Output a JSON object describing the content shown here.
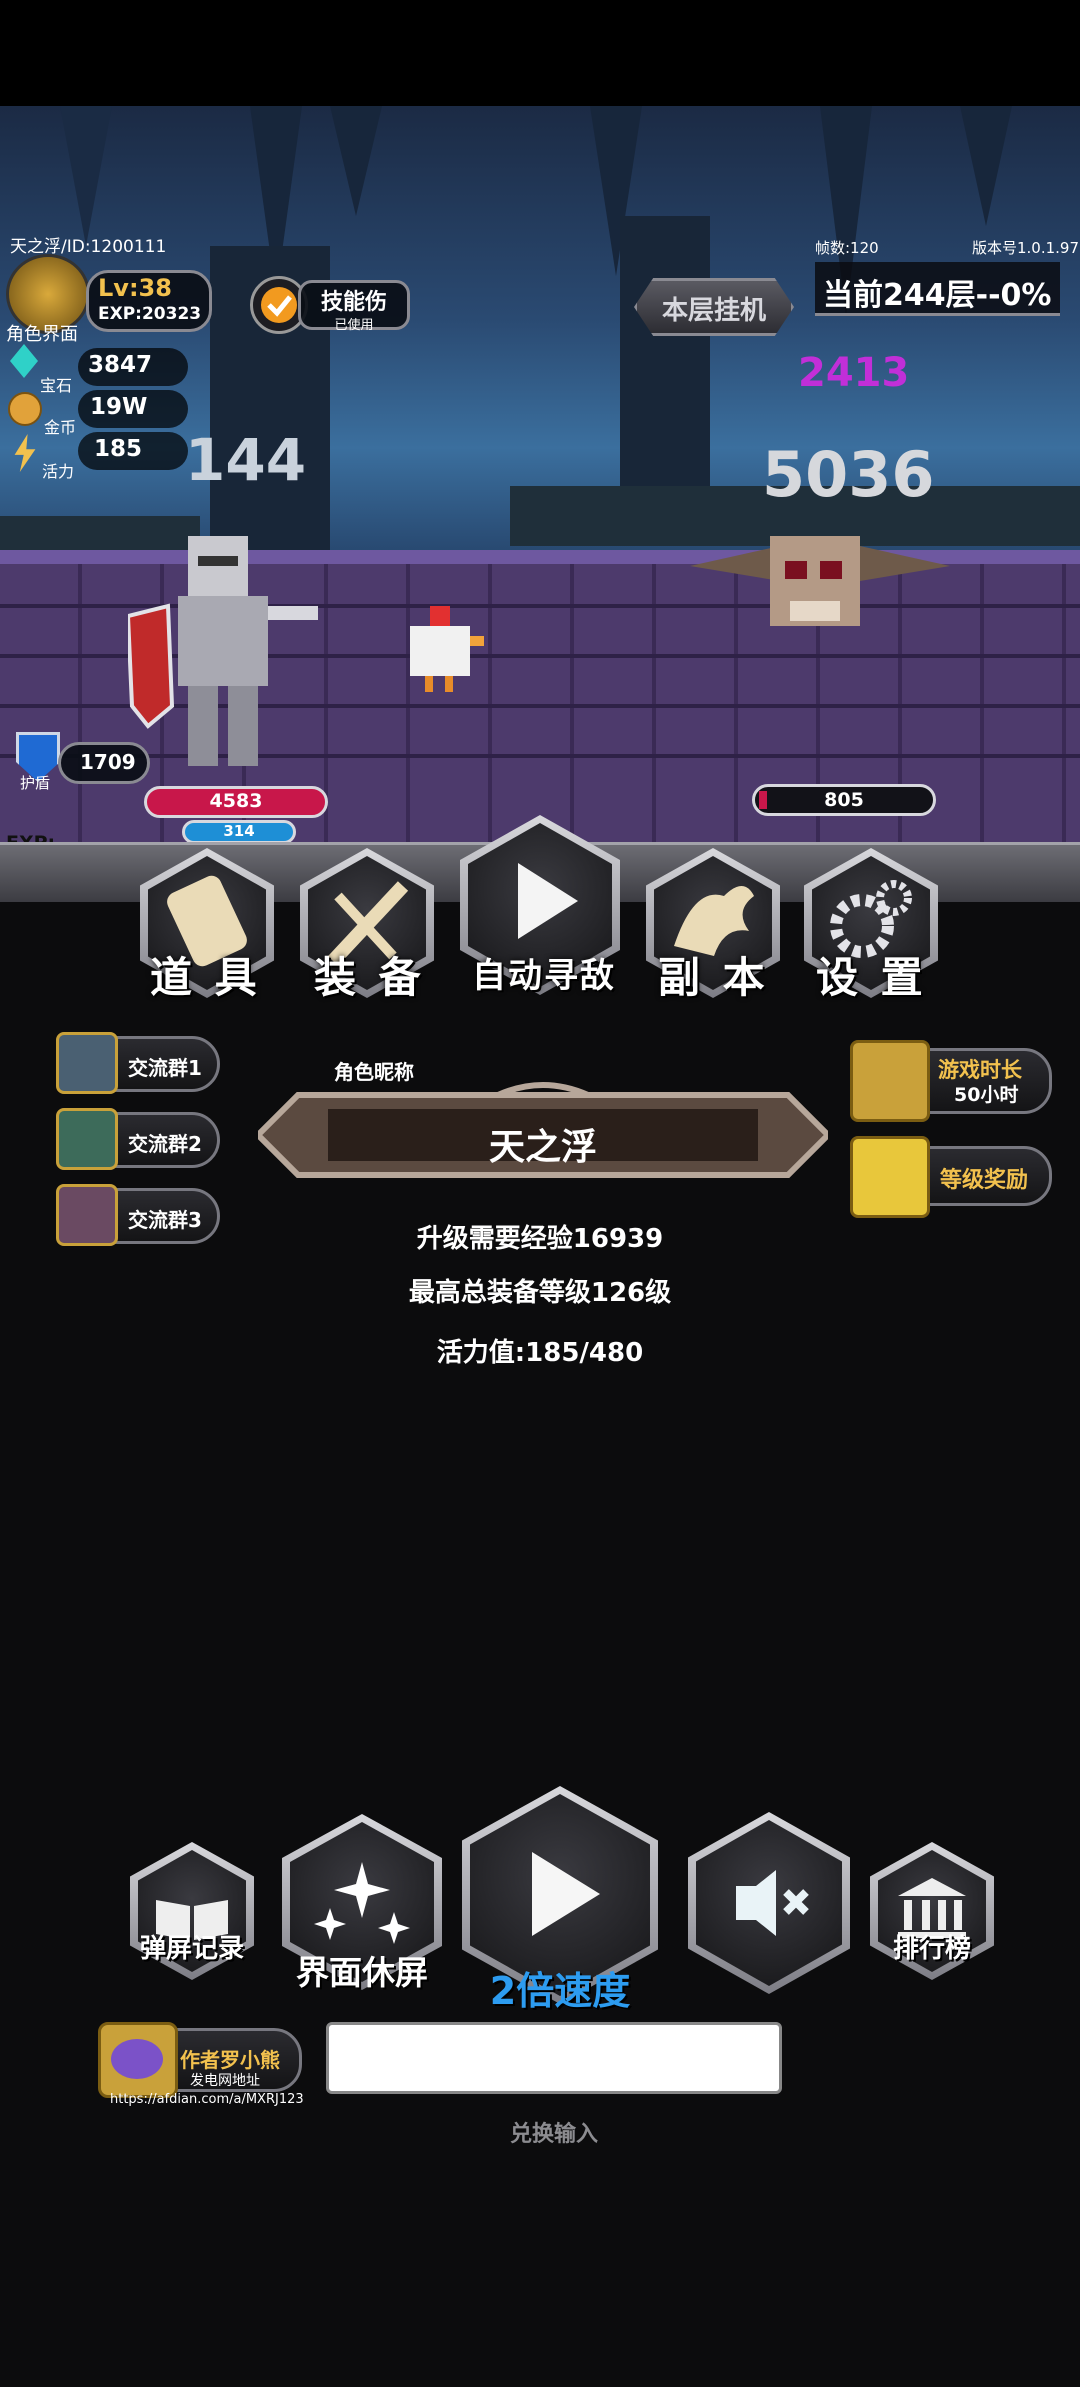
{
  "hud": {
    "player_id": "天之浮/ID:1200111",
    "level": "Lv:38",
    "exp": "EXP:20323",
    "role_label": "角色界面",
    "skill_button": "技能伤",
    "skill_sub": "已使用",
    "floor_button": "本层挂机",
    "fps": "帧数:120",
    "version": "版本号1.0.1.97",
    "floor_progress": "当前244层--0%",
    "gems_label": "宝石",
    "gems_value": "3847",
    "gold_label": "金币",
    "gold_value": "19W",
    "energy_label": "活力",
    "energy_value": "185",
    "shield_label": "护盾",
    "shield_value": "1709",
    "exp_bar_label": "EXP:"
  },
  "battle": {
    "damage_player": "144",
    "damage_enemy": "5036",
    "crit_number": "2413",
    "player_hp": "4583",
    "player_mp": "314",
    "enemy_hp": "805"
  },
  "menu": {
    "items": [
      {
        "label": "道 具",
        "icon": "scroll-icon"
      },
      {
        "label": "装 备",
        "icon": "sword-icon"
      },
      {
        "label": "自动寻敌",
        "icon": "play-icon"
      },
      {
        "label": "副 本",
        "icon": "dragon-icon"
      },
      {
        "label": "设 置",
        "icon": "gear-icon"
      }
    ]
  },
  "groups": [
    "交流群1",
    "交流群2",
    "交流群3"
  ],
  "nickname_label": "角色昵称",
  "nickname": "天之浮",
  "right_buttons": [
    {
      "title": "游戏时长",
      "sub": "50小时"
    },
    {
      "title": "等级奖励",
      "sub": ""
    }
  ],
  "stats": {
    "upgrade_exp": "升级需要经验16939",
    "max_equip": "最高总装备等级126级",
    "energy": "活力值:185/480"
  },
  "bottom": {
    "barrage": "弹屏记录",
    "screensaver": "界面休屏",
    "speed": "2倍速度",
    "rank": "排行榜"
  },
  "author": {
    "name": "作者罗小熊",
    "sub": "发电网地址",
    "url": "https://afdian.com/a/MXRJ123"
  },
  "redeem": {
    "input_value": "",
    "label": "兑换输入"
  },
  "colors": {
    "gold": "#f2c14e",
    "purple": "#c12fd8",
    "hp_red": "#c8174a",
    "mp_blue": "#1e8fd6",
    "ui_gray": "#8a8a92"
  }
}
